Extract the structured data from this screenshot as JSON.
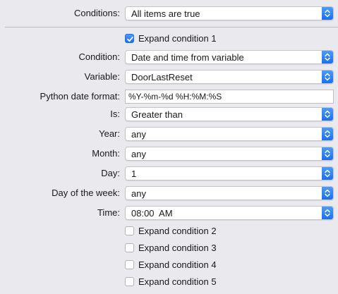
{
  "conditions": {
    "label": "Conditions:",
    "value": "All items are true"
  },
  "condition1": {
    "expand_label": "Expand condition 1",
    "expand_checked": true,
    "fields": {
      "condition": {
        "label": "Condition:",
        "value": "Date and time from variable"
      },
      "variable": {
        "label": "Variable:",
        "value": "DoorLastReset"
      },
      "python_date_format": {
        "label": "Python date format:",
        "value": "%Y-%m-%d %H:%M:%S"
      },
      "is": {
        "label": "Is:",
        "value": "Greater than"
      },
      "year": {
        "label": "Year:",
        "value": "any"
      },
      "month": {
        "label": "Month:",
        "value": "any"
      },
      "day": {
        "label": "Day:",
        "value": "1"
      },
      "day_of_week": {
        "label": "Day of the week:",
        "value": "any"
      },
      "time": {
        "label": "Time:",
        "value": "08:00  AM"
      }
    }
  },
  "other_conditions": [
    {
      "label": "Expand condition 2",
      "checked": false
    },
    {
      "label": "Expand condition 3",
      "checked": false
    },
    {
      "label": "Expand condition 4",
      "checked": false
    },
    {
      "label": "Expand condition 5",
      "checked": false
    }
  ],
  "icons": {
    "popup_arrows": "up-down-chevron-icon",
    "checkmark": "checkmark-icon"
  },
  "colors": {
    "accent": "#1a6ff0",
    "background": "#e9e9ee"
  }
}
